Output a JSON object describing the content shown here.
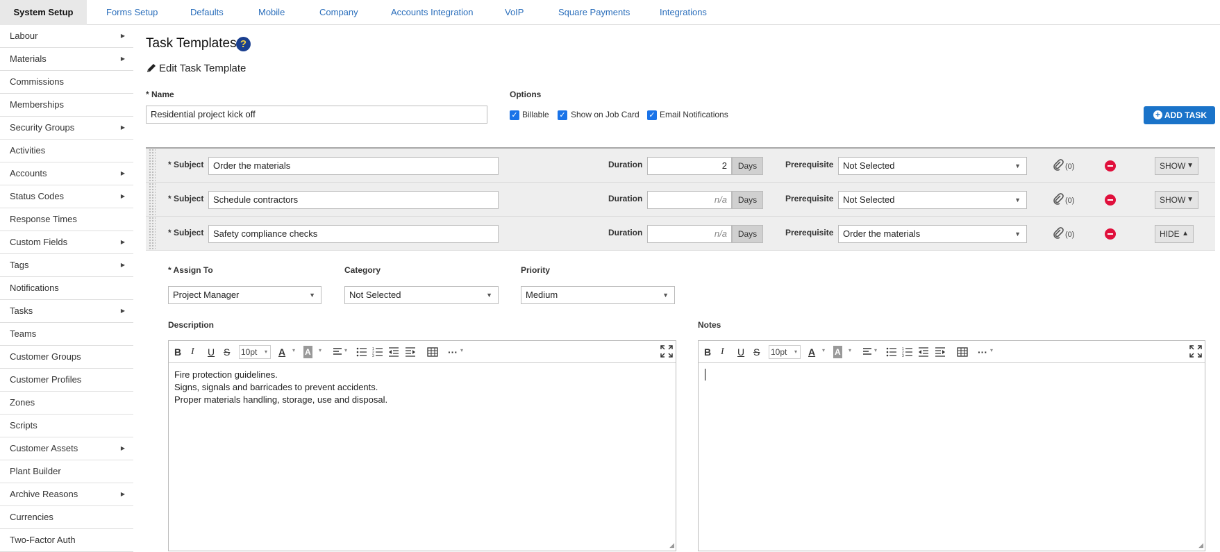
{
  "top_tabs": [
    "System Setup",
    "Forms Setup",
    "Defaults",
    "Mobile",
    "Company",
    "Accounts Integration",
    "VoIP",
    "Square Payments",
    "Integrations"
  ],
  "sidebar": {
    "items": [
      {
        "label": "Labour",
        "arrow": "▶"
      },
      {
        "label": "Materials",
        "arrow": "▶"
      },
      {
        "label": "Commissions",
        "arrow": ""
      },
      {
        "label": "Memberships",
        "arrow": ""
      },
      {
        "label": "Security Groups",
        "arrow": "▶"
      },
      {
        "label": "Activities",
        "arrow": ""
      },
      {
        "label": "Accounts",
        "arrow": "▶"
      },
      {
        "label": "Status Codes",
        "arrow": "▶"
      },
      {
        "label": "Response Times",
        "arrow": ""
      },
      {
        "label": "Custom Fields",
        "arrow": "▶"
      },
      {
        "label": "Tags",
        "arrow": "▶"
      },
      {
        "label": "Notifications",
        "arrow": ""
      },
      {
        "label": "Tasks",
        "arrow": "▶"
      },
      {
        "label": "Teams",
        "arrow": ""
      },
      {
        "label": "Customer Groups",
        "arrow": ""
      },
      {
        "label": "Customer Profiles",
        "arrow": ""
      },
      {
        "label": "Zones",
        "arrow": ""
      },
      {
        "label": "Scripts",
        "arrow": ""
      },
      {
        "label": "Customer Assets",
        "arrow": "▶"
      },
      {
        "label": "Plant Builder",
        "arrow": ""
      },
      {
        "label": "Archive Reasons",
        "arrow": "▶"
      },
      {
        "label": "Currencies",
        "arrow": ""
      },
      {
        "label": "Two-Factor Auth",
        "arrow": ""
      }
    ]
  },
  "page": {
    "title": "Task Templates",
    "help_glyph": "?",
    "subtitle": "Edit Task Template",
    "name_label": "* Name",
    "name_value": "Residential project kick off",
    "options_label": "Options",
    "options": [
      {
        "label": "Billable",
        "checked": true
      },
      {
        "label": "Show on Job Card",
        "checked": true
      },
      {
        "label": "Email Notifications",
        "checked": true
      }
    ],
    "add_task_label": "ADD TASK",
    "check_glyph": "✓"
  },
  "tasks": {
    "subject_label": "* Subject",
    "duration_label": "Duration",
    "days_label": "Days",
    "prerequisite_label": "Prerequisite",
    "rows": [
      {
        "subject": "Order the materials",
        "duration": "2",
        "prerequisite": "Not Selected",
        "attachments": "(0)",
        "toggle": "SHOW",
        "toggle_arrow": "▼"
      },
      {
        "subject": "Schedule contractors",
        "duration": "n/a",
        "prerequisite": "Not Selected",
        "attachments": "(0)",
        "toggle": "SHOW",
        "toggle_arrow": "▼"
      },
      {
        "subject": "Safety compliance checks",
        "duration": "n/a",
        "prerequisite": "Order the materials",
        "attachments": "(0)",
        "toggle": "HIDE",
        "toggle_arrow": "▲"
      }
    ]
  },
  "details": {
    "assign_label": "* Assign To",
    "assign_value": "Project Manager",
    "category_label": "Category",
    "category_value": "Not Selected",
    "priority_label": "Priority",
    "priority_value": "Medium",
    "description_label": "Description",
    "notes_label": "Notes",
    "description_lines": [
      "Fire protection guidelines.",
      "Signs, signals and barricades to prevent accidents.",
      "Proper materials handling, storage, use and disposal."
    ],
    "font_size": "10pt",
    "toolbar_glyphs": {
      "bold": "B",
      "italic": "I",
      "underline": "U",
      "strike": "S",
      "font_color": "A",
      "bg_color": "A",
      "more": "···",
      "caret": "▾"
    }
  },
  "icons": {
    "help": "help-circle-icon",
    "pencil": "pencil-icon",
    "add": "plus-circle-icon",
    "attachment": "paperclip-icon",
    "remove": "minus-circle-icon",
    "fullscreen": "fullscreen-icon",
    "drag": "drag-handle-icon"
  },
  "colors": {
    "link_blue": "#2a6ebb",
    "primary_button": "#1a73c9",
    "remove_red": "#e0103c",
    "help_navy": "#1a3f8f",
    "checkbox_blue": "#1a73e8"
  }
}
